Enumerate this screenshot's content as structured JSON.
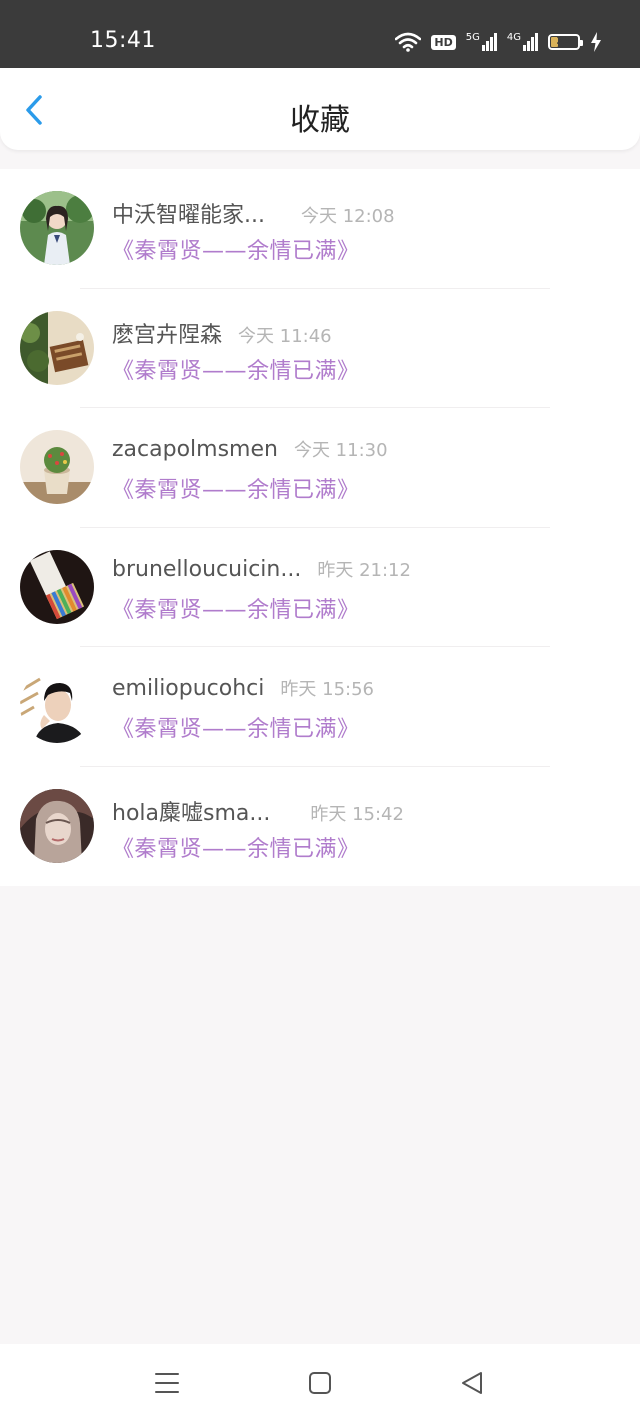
{
  "status_bar": {
    "time": "15:41",
    "hd": "HD",
    "net1": "5G",
    "net2": "4G",
    "battery": "25",
    "battery_level": 0.25
  },
  "header": {
    "back_icon": "chevron-left-icon",
    "title": "收藏"
  },
  "colors": {
    "accent": "#2b9bea",
    "subtitle": "#b07ccc",
    "name": "#555555",
    "time": "#b5b5b5"
  },
  "items": [
    {
      "name": "中沃智曜能家...",
      "time": "今天 12:08",
      "subtitle": "《秦霄贤——余情已满》"
    },
    {
      "name": "麽宫卉陧森",
      "time": "今天 11:46",
      "subtitle": "《秦霄贤——余情已满》"
    },
    {
      "name": "zacapolmsmen",
      "time": "今天 11:30",
      "subtitle": "《秦霄贤——余情已满》"
    },
    {
      "name": "brunelloucuicin...",
      "time": "昨天 21:12",
      "subtitle": "《秦霄贤——余情已满》"
    },
    {
      "name": "emiliopucohci",
      "time": "昨天 15:56",
      "subtitle": "《秦霄贤——余情已满》"
    },
    {
      "name": "hola麋嘘sma...",
      "time": "昨天 15:42",
      "subtitle": "《秦霄贤——余情已满》"
    }
  ],
  "bottom_nav": {
    "menu_icon": "menu-icon",
    "home_icon": "home-square-icon",
    "back_icon": "back-triangle-icon"
  }
}
